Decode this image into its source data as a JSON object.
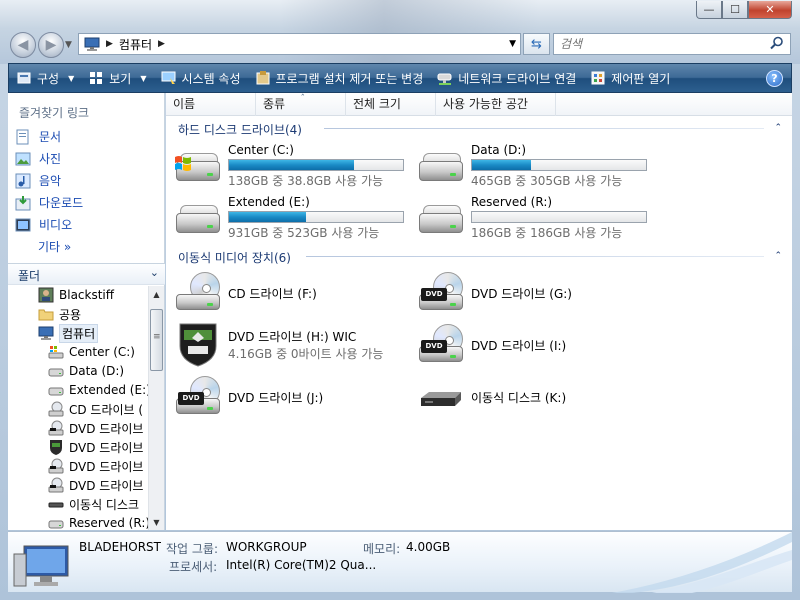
{
  "window": {
    "caption_buttons": {
      "minimize": "—",
      "maximize": "☐",
      "close": "✕"
    }
  },
  "nav": {
    "address_crumb": "컴퓨터",
    "search_placeholder": "검색"
  },
  "toolbar": {
    "items": [
      {
        "label": "구성",
        "icon": "organize-icon",
        "has_arrow": true
      },
      {
        "label": "보기",
        "icon": "views-icon",
        "has_arrow": true
      },
      {
        "label": "시스템 속성",
        "icon": "system-properties-icon",
        "has_arrow": false
      },
      {
        "label": "프로그램 설치 제거 또는 변경",
        "icon": "uninstall-program-icon",
        "has_arrow": false
      },
      {
        "label": "네트워크 드라이브 연결",
        "icon": "map-network-drive-icon",
        "has_arrow": false
      },
      {
        "label": "제어판 열기",
        "icon": "control-panel-icon",
        "has_arrow": false
      }
    ],
    "help": "?"
  },
  "left_pane": {
    "favorites_title": "즐겨찾기 링크",
    "favorites": [
      {
        "label": "문서",
        "icon": "documents-icon"
      },
      {
        "label": "사진",
        "icon": "pictures-icon"
      },
      {
        "label": "음악",
        "icon": "music-icon"
      },
      {
        "label": "다운로드",
        "icon": "downloads-icon"
      },
      {
        "label": "비디오",
        "icon": "videos-icon"
      }
    ],
    "more": "기타 »",
    "folders_title": "폴더",
    "tree": [
      {
        "label": "Blackstiff",
        "icon": "user-folder-icon",
        "indent": 1
      },
      {
        "label": "공용",
        "icon": "folder-icon",
        "indent": 1
      },
      {
        "label": "컴퓨터",
        "icon": "computer-icon",
        "indent": 1,
        "selected": true
      },
      {
        "label": "Center (C:)",
        "icon": "windows-drive-icon",
        "indent": 2
      },
      {
        "label": "Data (D:)",
        "icon": "hard-drive-icon",
        "indent": 2
      },
      {
        "label": "Extended (E:)",
        "icon": "hard-drive-icon",
        "indent": 2
      },
      {
        "label": "CD 드라이브 (",
        "icon": "cd-drive-icon",
        "indent": 2
      },
      {
        "label": "DVD 드라이브",
        "icon": "dvd-drive-icon",
        "indent": 2
      },
      {
        "label": "DVD 드라이브",
        "icon": "dvd-shield-icon",
        "indent": 2
      },
      {
        "label": "DVD 드라이브",
        "icon": "dvd-drive-icon",
        "indent": 2
      },
      {
        "label": "DVD 드라이브",
        "icon": "dvd-drive-icon",
        "indent": 2
      },
      {
        "label": "이동식 디스크",
        "icon": "removable-disk-icon",
        "indent": 2
      },
      {
        "label": "Reserved (R:)",
        "icon": "hard-drive-icon",
        "indent": 2
      }
    ]
  },
  "columns": [
    "이름",
    "종류",
    "전체 크기",
    "사용 가능한 공간"
  ],
  "groups": {
    "hard_disks": "하드 디스크 드라이브(4)",
    "removable": "이동식 미디어 장치(6)"
  },
  "hard_drives": [
    {
      "name": "Center (C:)",
      "free_text": "138GB 중 38.8GB 사용 가능",
      "used_fraction": 0.72,
      "icon": "windows-drive-icon"
    },
    {
      "name": "Data (D:)",
      "free_text": "465GB 중 305GB 사용 가능",
      "used_fraction": 0.34,
      "icon": "hard-drive-icon"
    },
    {
      "name": "Extended (E:)",
      "free_text": "931GB 중 523GB 사용 가능",
      "used_fraction": 0.44,
      "icon": "hard-drive-icon"
    },
    {
      "name": "Reserved (R:)",
      "free_text": "186GB 중 186GB 사용 가능",
      "used_fraction": 0.0,
      "icon": "hard-drive-icon"
    }
  ],
  "media_drives": [
    {
      "name": "CD 드라이브 (F:)",
      "sub": "",
      "icon": "cd-drive-icon"
    },
    {
      "name": "DVD 드라이브 (G:)",
      "sub": "",
      "icon": "dvd-drive-icon"
    },
    {
      "name": "DVD 드라이브 (H:) WIC",
      "sub": "4.16GB 중 0바이트 사용 가능",
      "icon": "dvd-shield-icon"
    },
    {
      "name": "DVD 드라이브 (I:)",
      "sub": "",
      "icon": "dvd-drive-icon"
    },
    {
      "name": "DVD 드라이브 (J:)",
      "sub": "",
      "icon": "dvd-drive-icon"
    },
    {
      "name": "이동식 디스크 (K:)",
      "sub": "",
      "icon": "removable-disk-icon"
    }
  ],
  "details": {
    "computer_name": "BLADEHORST",
    "workgroup_label": "작업 그룹:",
    "workgroup_value": "WORKGROUP",
    "memory_label": "메모리:",
    "memory_value": "4.00GB",
    "processor_label": "프로세서:",
    "processor_value": "Intel(R) Core(TM)2 Qua..."
  },
  "colors": {
    "toolbar": "#2d5f8f",
    "link": "#1a4bb2",
    "group_header": "#1c3a73",
    "bar_fill": "#1a8bc6"
  }
}
